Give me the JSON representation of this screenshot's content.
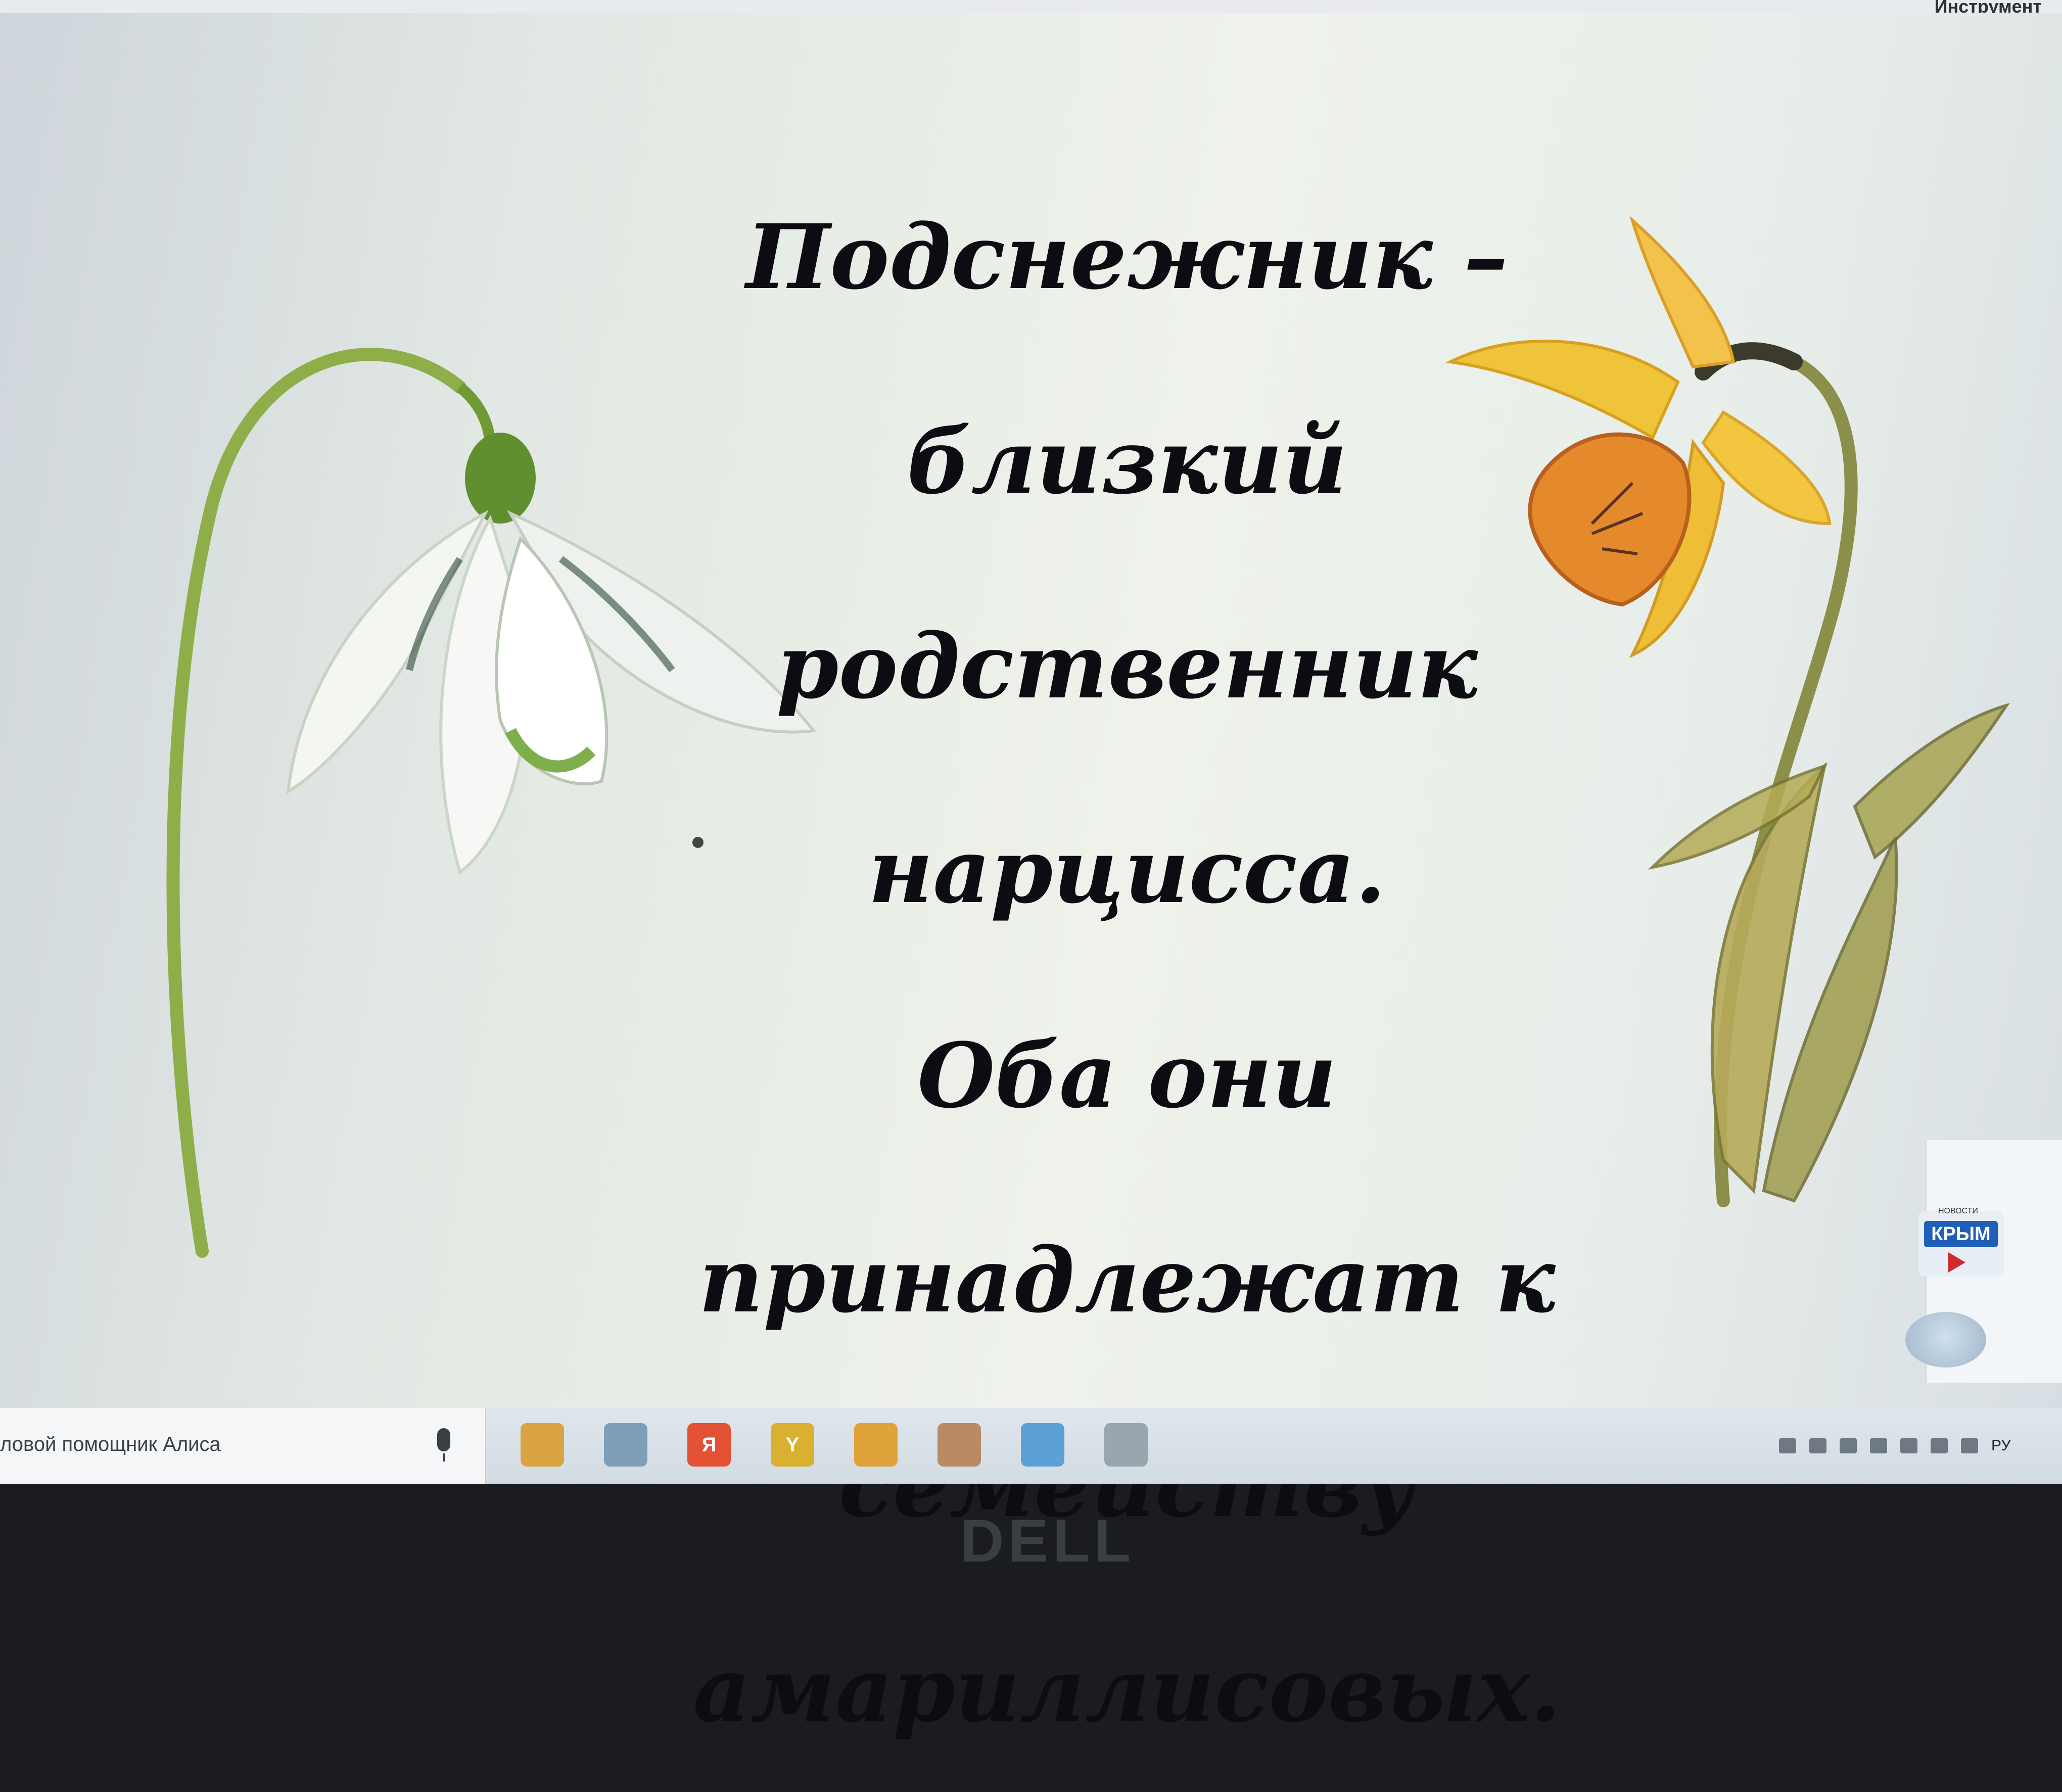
{
  "window": {
    "toolbar_label": "Инструмент"
  },
  "slide": {
    "lines": [
      "Подснежник –",
      "близкий",
      "родственник",
      "нарцисса.",
      "Оба они",
      "принадлежат к",
      "семейству",
      "амариллисовых."
    ]
  },
  "widget": {
    "news_small": "НОВОСТИ",
    "news_brand": "КРЫМ"
  },
  "taskbar": {
    "search_text": "ловой помощник Алиса",
    "apps": [
      {
        "name": "file-explorer-icon",
        "glyph": "",
        "color": "#d9a441"
      },
      {
        "name": "calendar-icon",
        "glyph": "",
        "color": "#7f9fb8"
      },
      {
        "name": "yandex-icon",
        "glyph": "Я",
        "color": "#e35234"
      },
      {
        "name": "yandex-browser-icon",
        "glyph": "Y",
        "color": "#d9b030"
      },
      {
        "name": "chrome-icon",
        "glyph": "",
        "color": "#e0a23a"
      },
      {
        "name": "app-icon",
        "glyph": "",
        "color": "#b98a63"
      },
      {
        "name": "telegram-icon",
        "glyph": "",
        "color": "#5ba0d6"
      },
      {
        "name": "photo-icon",
        "glyph": "",
        "color": "#9aa6ae"
      }
    ],
    "language": "РУ"
  },
  "monitor": {
    "brand": "DELL"
  }
}
